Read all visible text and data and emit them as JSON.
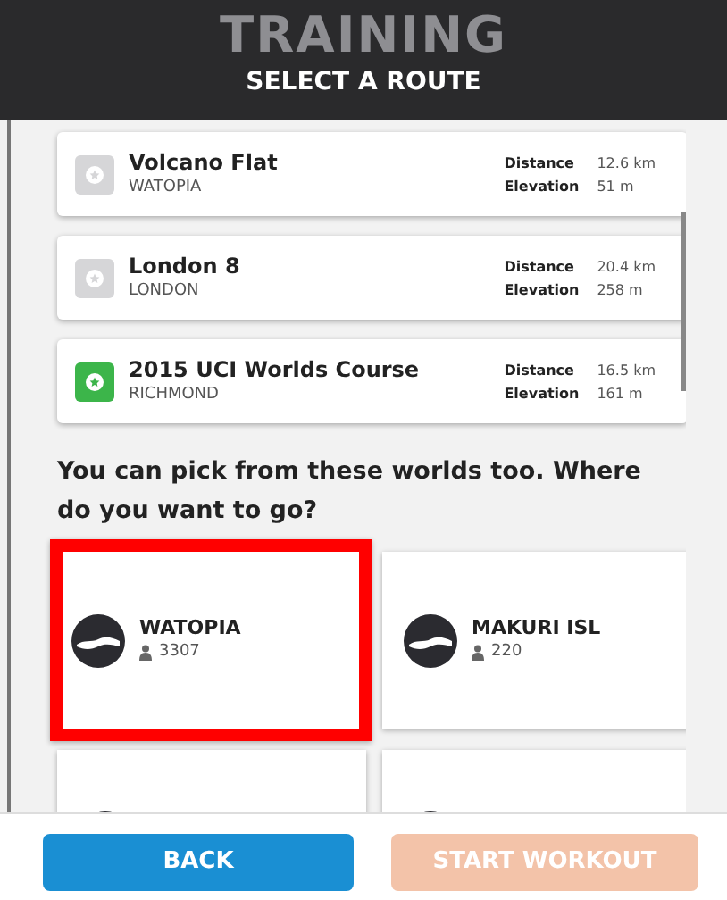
{
  "header": {
    "title": "TRAINING",
    "subtitle": "SELECT A ROUTE"
  },
  "routes": [
    {
      "name": "Volcano Flat",
      "world": "WATOPIA",
      "color": "#d6d6d8",
      "distance_label": "Distance",
      "distance": "12.6 km",
      "elevation_label": "Elevation",
      "elevation": "51 m"
    },
    {
      "name": "London 8",
      "world": "LONDON",
      "color": "#d6d6d8",
      "distance_label": "Distance",
      "distance": "20.4 km",
      "elevation_label": "Elevation",
      "elevation": "258 m"
    },
    {
      "name": "2015 UCI Worlds Course",
      "world": "RICHMOND",
      "color": "#3cb54a",
      "distance_label": "Distance",
      "distance": "16.5 km",
      "elevation_label": "Elevation",
      "elevation": "161 m"
    }
  ],
  "prompt": "You can pick from these worlds too. Where do you want to go?",
  "worlds": [
    {
      "name": "WATOPIA",
      "riders": "3307",
      "highlighted": true
    },
    {
      "name": "MAKURI ISL",
      "riders": "220",
      "highlighted": false
    },
    {
      "highlighted": false
    },
    {
      "highlighted": false
    }
  ],
  "buttons": [
    {
      "label": "BACK",
      "disabled": false
    },
    {
      "label": "START WORKOUT",
      "disabled": true
    }
  ]
}
